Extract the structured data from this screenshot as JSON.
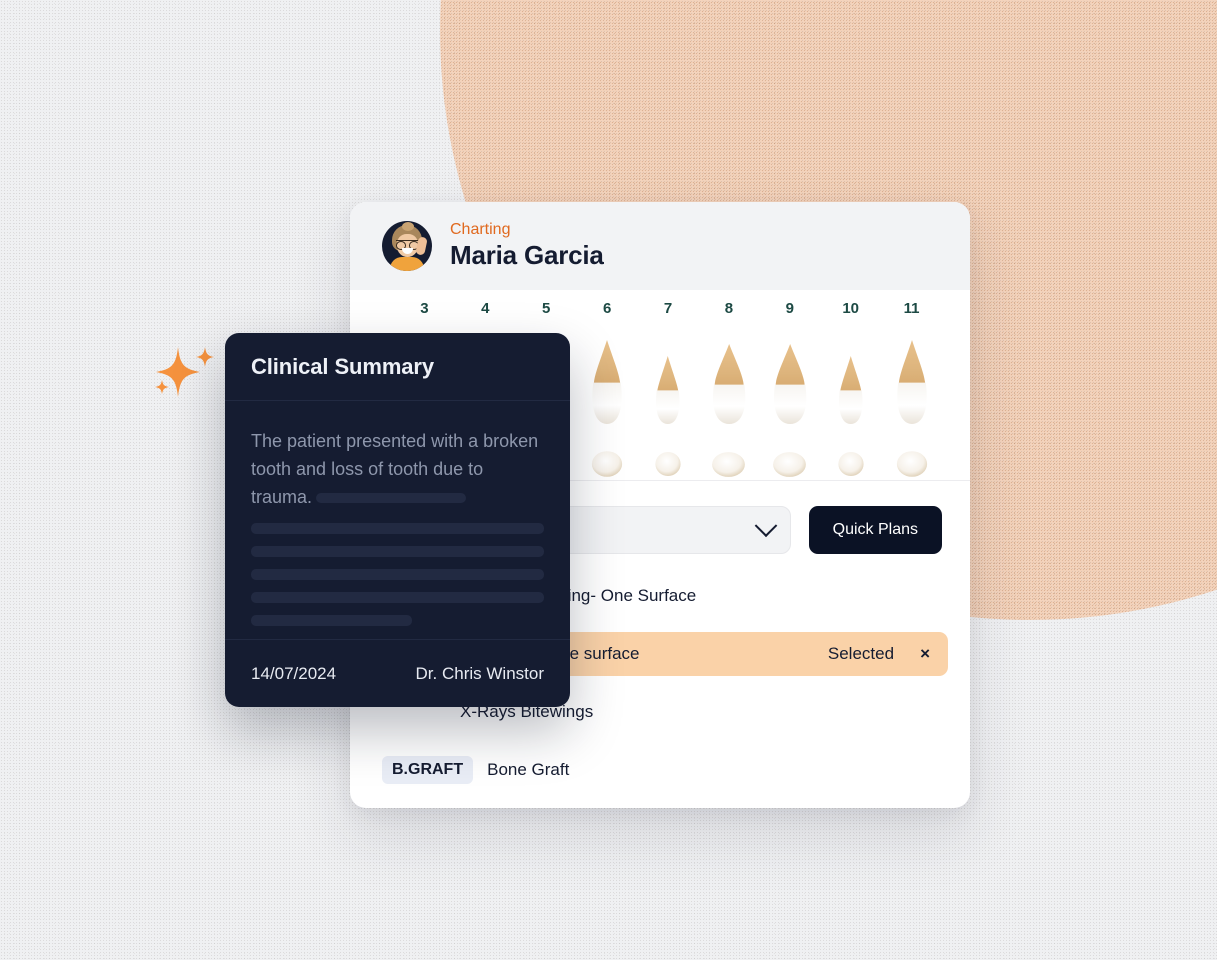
{
  "background": {
    "base_color": "#eff0f2",
    "accent_circle_color": "#f3d2ba"
  },
  "sparkle": {
    "icon": "sparkle-icon",
    "color": "#f5923e"
  },
  "card": {
    "header": {
      "avatar": "patient-avatar",
      "kicker": "Charting",
      "patient_name": "Maria Garcia",
      "kicker_color": "#e0691f"
    },
    "chart": {
      "tooth_numbers": [
        "3",
        "4",
        "5",
        "6",
        "7",
        "8",
        "9",
        "10",
        "11"
      ],
      "rendered_teeth": [
        {
          "number": "6",
          "root_h": 84,
          "root_w": 20,
          "crown_w": 30,
          "crown_h": 28
        },
        {
          "number": "7",
          "root_h": 68,
          "root_w": 15,
          "crown_w": 24,
          "crown_h": 26
        },
        {
          "number": "8",
          "root_h": 80,
          "root_w": 23,
          "crown_w": 33,
          "crown_h": 27
        },
        {
          "number": "9",
          "root_h": 80,
          "root_w": 23,
          "crown_w": 33,
          "crown_h": 27
        },
        {
          "number": "10",
          "root_h": 68,
          "root_w": 15,
          "crown_w": 24,
          "crown_h": 26
        },
        {
          "number": "11",
          "root_h": 84,
          "root_w": 20,
          "crown_w": 30,
          "crown_h": 28
        }
      ],
      "number_color": "#1d4a44"
    },
    "controls": {
      "select_value": "",
      "select_icon": "chevron-down-icon",
      "quick_plans_label": "Quick Plans"
    },
    "treatments": [
      {
        "code": "",
        "name": "Composite Filling- One Surface",
        "selected": false
      },
      {
        "code": "",
        "name": "Amalgam - One surface",
        "selected": true,
        "status": "Selected",
        "dismiss": "×"
      },
      {
        "code": "",
        "name": "X-Rays Bitewings",
        "selected": false
      },
      {
        "code": "B.GRAFT",
        "name": "Bone Graft",
        "selected": false
      }
    ],
    "selected_row_color": "#fad2a8"
  },
  "summary": {
    "title": "Clinical Summary",
    "body_text": "The patient presented with a broken tooth and loss of tooth due to trauma.",
    "skeleton_widths": [
      "100%",
      "100%",
      "100%",
      "100%",
      "55%"
    ],
    "date": "14/07/2024",
    "author": "Dr. Chris Winstor",
    "panel_color": "#151c31"
  }
}
